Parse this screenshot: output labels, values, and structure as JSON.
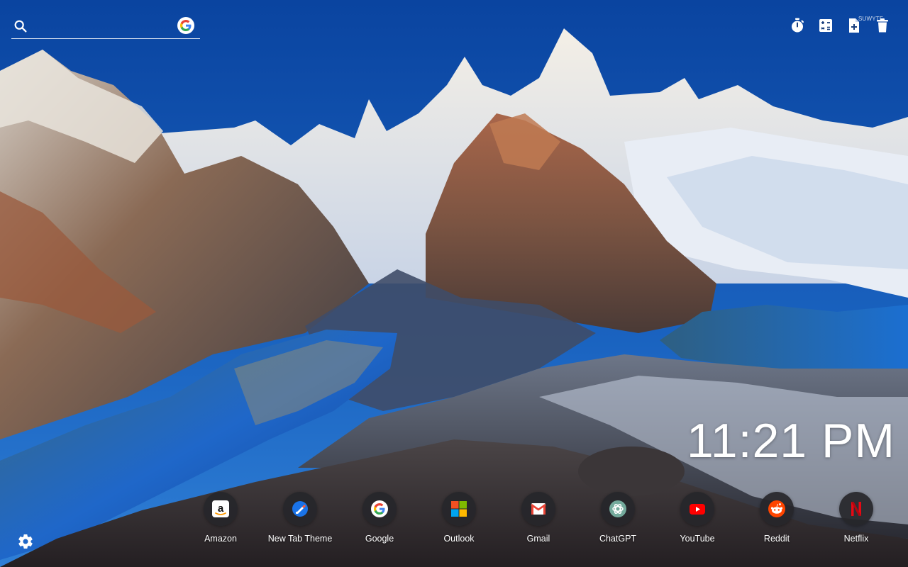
{
  "search": {
    "value": "",
    "placeholder": "",
    "icon": "search-icon",
    "engine_icon": "google-icon"
  },
  "tools": [
    {
      "icon": "stopwatch-icon"
    },
    {
      "icon": "calculator-icon"
    },
    {
      "icon": "add-document-icon",
      "label": "SUWYTF"
    },
    {
      "icon": "trash-icon"
    }
  ],
  "clock": {
    "time": "11:21 PM"
  },
  "shortcuts": [
    {
      "label": "Amazon",
      "icon": "amazon-icon"
    },
    {
      "label": "New Tab Theme",
      "icon": "new-tab-theme-icon"
    },
    {
      "label": "Google",
      "icon": "google-icon"
    },
    {
      "label": "Outlook",
      "icon": "outlook-icon"
    },
    {
      "label": "Gmail",
      "icon": "gmail-icon"
    },
    {
      "label": "ChatGPT",
      "icon": "chatgpt-icon"
    },
    {
      "label": "YouTube",
      "icon": "youtube-icon"
    },
    {
      "label": "Reddit",
      "icon": "reddit-icon"
    },
    {
      "label": "Netflix",
      "icon": "netflix-icon"
    }
  ],
  "settings": {
    "icon": "gear-icon"
  },
  "colors": {
    "sky": "#0d4fa8",
    "text": "#ffffff",
    "tile": "#26262a"
  }
}
